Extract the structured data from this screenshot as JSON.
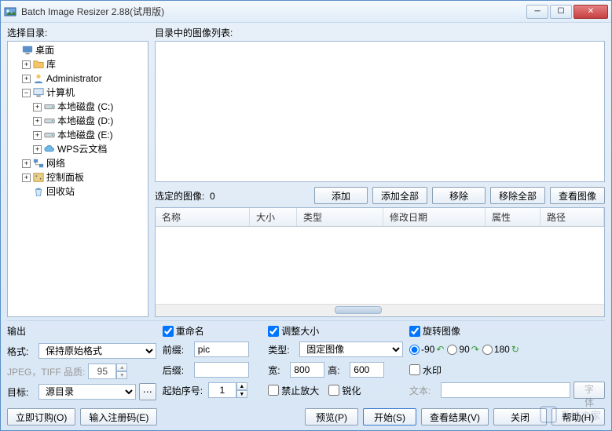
{
  "titlebar": {
    "title": "Batch Image Resizer 2.88(试用版)"
  },
  "left": {
    "label": "选择目录:",
    "tree": {
      "desktop": "桌面",
      "libraries": "库",
      "admin": "Administrator",
      "computer": "计算机",
      "drives": {
        "c": "本地磁盘 (C:)",
        "d": "本地磁盘 (D:)",
        "e": "本地磁盘 (E:)"
      },
      "wps": "WPS云文档",
      "network": "网络",
      "control_panel": "控制面板",
      "recycle": "回收站"
    }
  },
  "right": {
    "list_label": "目录中的图像列表:",
    "selected_label": "选定的图像:",
    "selected_count": "0",
    "buttons": {
      "add": "添加",
      "add_all": "添加全部",
      "remove": "移除",
      "remove_all": "移除全部",
      "view": "查看图像"
    },
    "columns": {
      "name": "名称",
      "size": "大小",
      "type": "类型",
      "modified": "修改日期",
      "attrs": "属性",
      "path": "路径"
    }
  },
  "output": {
    "section": "输出",
    "format_label": "格式:",
    "format_value": "保持原始格式",
    "quality_label": "JPEG，TIFF 品质:",
    "quality_value": "95",
    "target_label": "目标:",
    "target_value": "源目录"
  },
  "rename": {
    "checkbox": "重命名",
    "prefix_label": "前缀:",
    "prefix_value": "pic",
    "suffix_label": "后缀:",
    "suffix_value": "",
    "start_label": "起始序号:",
    "start_value": "1"
  },
  "resize": {
    "checkbox": "调整大小",
    "type_label": "类型:",
    "type_value": "固定图像",
    "width_label": "宽:",
    "width_value": "800",
    "height_label": "高:",
    "height_value": "600",
    "no_enlarge": "禁止放大",
    "sharpen": "锐化"
  },
  "rotate": {
    "checkbox": "旋转图像",
    "neg90": "-90",
    "pos90": "90",
    "r180": "180"
  },
  "watermark": {
    "checkbox": "水印",
    "text_label": "文本:",
    "font_btn": "字体"
  },
  "footer": {
    "order": "立即订购(O)",
    "register": "输入注册码(E)",
    "preview": "预览(P)",
    "start": "开始(S)",
    "results": "查看结果(V)",
    "close": "关闭",
    "help": "帮助(H)"
  },
  "brand": "系统之家"
}
